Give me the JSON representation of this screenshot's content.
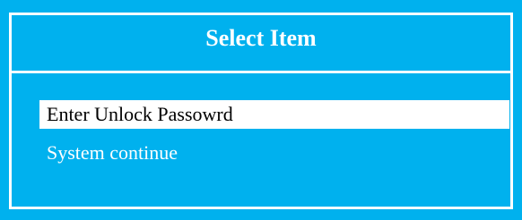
{
  "dialog": {
    "title": "Select Item",
    "items": [
      {
        "label": "Enter Unlock Passowrd",
        "selected": true
      },
      {
        "label": "System continue",
        "selected": false
      }
    ]
  },
  "colors": {
    "background": "#00b1ee",
    "frame": "#ffffff",
    "selection_background": "#ffffff",
    "selected_text": "#000000",
    "text": "#ffffff"
  }
}
